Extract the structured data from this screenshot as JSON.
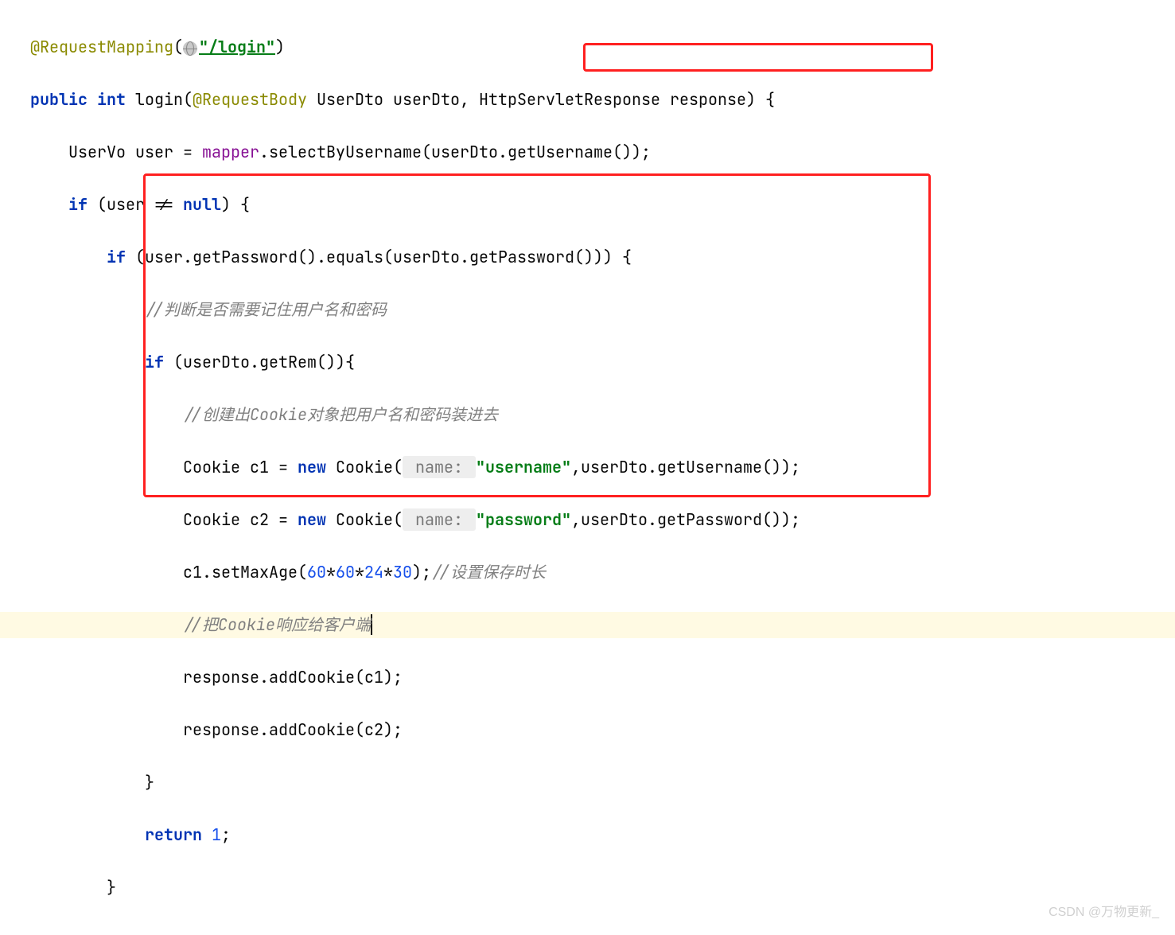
{
  "code": {
    "l1_annotation": "@RequestMapping",
    "l1_paren_open": "(",
    "l1_string": "\"/login\"",
    "l1_paren_close": ")",
    "l2_kw_public": "public",
    "l2_kw_int": "int",
    "l2_method": " login(",
    "l2_anno_body": "@RequestBody",
    "l2_params": " UserDto userDto, HttpServletResponse response) {",
    "l3_text1": "UserVo user = ",
    "l3_field": "mapper",
    "l3_text2": ".selectByUsername(userDto.getUsername());",
    "l4_kw_if": "if",
    "l4_text": " (user != ",
    "l4_kw_null": "null",
    "l4_text2": ") {",
    "l5_kw_if": "if",
    "l5_text": " (user.getPassword().equals(userDto.getPassword())) {",
    "l6_comment": "//判断是否需要记住用户名和密码",
    "l7_kw_if": "if",
    "l7_text": " (userDto.getRem()){",
    "l8_comment": "//创建出Cookie对象把用户名和密码装进去",
    "l9_text1": "Cookie c1 = ",
    "l9_kw_new": "new",
    "l9_text2": " Cookie(",
    "l9_hint": " name: ",
    "l9_string": "\"username\"",
    "l9_text3": ",userDto.getUsername());",
    "l10_text1": "Cookie c2 = ",
    "l10_kw_new": "new",
    "l10_text2": " Cookie(",
    "l10_hint": " name: ",
    "l10_string": "\"password\"",
    "l10_text3": ",userDto.getPassword());",
    "l11_text1": "c1.setMaxAge(",
    "l11_n1": "60",
    "l11_op1": "*",
    "l11_n2": "60",
    "l11_op2": "*",
    "l11_n3": "24",
    "l11_op3": "*",
    "l11_n4": "30",
    "l11_text2": ");",
    "l11_comment": "//设置保存时长",
    "l12_comment": "//把Cookie响应给客户端",
    "l13_text": "response.addCookie(c1);",
    "l14_text": "response.addCookie(c2);",
    "l15_brace": "}",
    "l16_kw_return": "return",
    "l16_text": " ",
    "l16_num": "1",
    "l16_semi": ";",
    "l17_brace": "}"
  },
  "watermark": "CSDN @万物更新_"
}
